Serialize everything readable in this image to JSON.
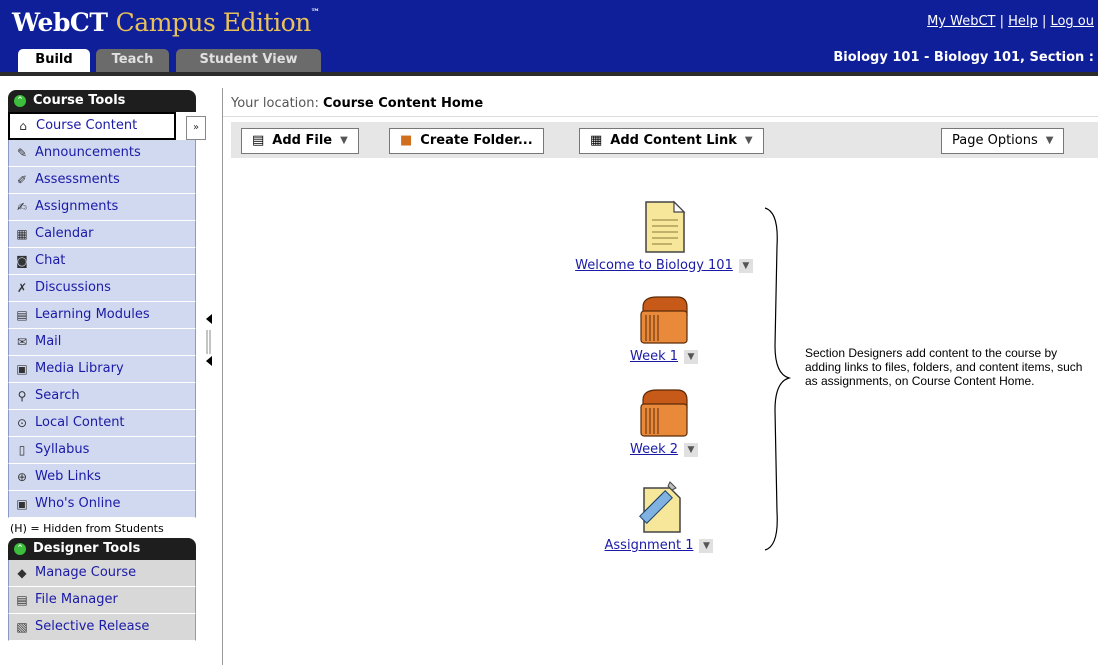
{
  "header": {
    "logo_brand": "WebCT",
    "logo_edition": "Campus Edition",
    "logo_tm": "™",
    "links": {
      "mywebct": "My WebCT",
      "help": "Help",
      "logout": "Log ou"
    },
    "tabs": {
      "build": "Build",
      "teach": "Teach",
      "student_view": "Student View"
    },
    "course_title": "Biology 101 - Biology 101, Section :"
  },
  "sidebar": {
    "course_tools_title": "Course Tools",
    "items": [
      {
        "label": "Course Content",
        "icon": "home-icon",
        "glyph": "⌂"
      },
      {
        "label": "Announcements",
        "icon": "megaphone-icon",
        "glyph": "✎"
      },
      {
        "label": "Assessments",
        "icon": "assessment-icon",
        "glyph": "✐"
      },
      {
        "label": "Assignments",
        "icon": "assignment-icon",
        "glyph": "✍"
      },
      {
        "label": "Calendar",
        "icon": "calendar-icon",
        "glyph": "▦"
      },
      {
        "label": "Chat",
        "icon": "chat-icon",
        "glyph": "◙"
      },
      {
        "label": "Discussions",
        "icon": "discussion-icon",
        "glyph": "✗"
      },
      {
        "label": "Learning Modules",
        "icon": "modules-icon",
        "glyph": "▤"
      },
      {
        "label": "Mail",
        "icon": "mail-icon",
        "glyph": "✉"
      },
      {
        "label": "Media Library",
        "icon": "media-library-icon",
        "glyph": "▣"
      },
      {
        "label": "Search",
        "icon": "search-icon",
        "glyph": "⚲"
      },
      {
        "label": "Local Content",
        "icon": "local-content-icon",
        "glyph": "⊙"
      },
      {
        "label": "Syllabus",
        "icon": "syllabus-icon",
        "glyph": "▯"
      },
      {
        "label": "Web Links",
        "icon": "web-links-icon",
        "glyph": "⊕"
      },
      {
        "label": "Who's Online",
        "icon": "whos-online-icon",
        "glyph": "▣"
      }
    ],
    "hidden_note": "(H) = Hidden from Students",
    "designer_tools_title": "Designer Tools",
    "designer_items": [
      {
        "label": "Manage Course",
        "icon": "manage-course-icon",
        "glyph": "◆"
      },
      {
        "label": "File Manager",
        "icon": "file-manager-icon",
        "glyph": "▤"
      },
      {
        "label": "Selective Release",
        "icon": "selective-release-icon",
        "glyph": "▧"
      }
    ]
  },
  "main": {
    "location_label": "Your location:",
    "location_value": "Course Content Home",
    "toolbar": {
      "add_file": "Add File",
      "create_folder": "Create Folder...",
      "add_content_link": "Add Content Link",
      "page_options": "Page Options"
    },
    "content_items": [
      {
        "label": "Welcome to Biology 101",
        "icon": "page-icon"
      },
      {
        "label": "Week 1",
        "icon": "folder-icon"
      },
      {
        "label": "Week 2",
        "icon": "folder-icon"
      },
      {
        "label": "Assignment 1",
        "icon": "assignment-icon"
      }
    ],
    "note": "Section Designers add content to the course by adding links to files, folders, and content items, such as assignments, on Course Content Home."
  },
  "colors": {
    "topbar": "#0f1f9a",
    "accent_gold": "#e7c15a",
    "sidebar_item": "#d1d9f0",
    "link": "#1a1aa6"
  }
}
